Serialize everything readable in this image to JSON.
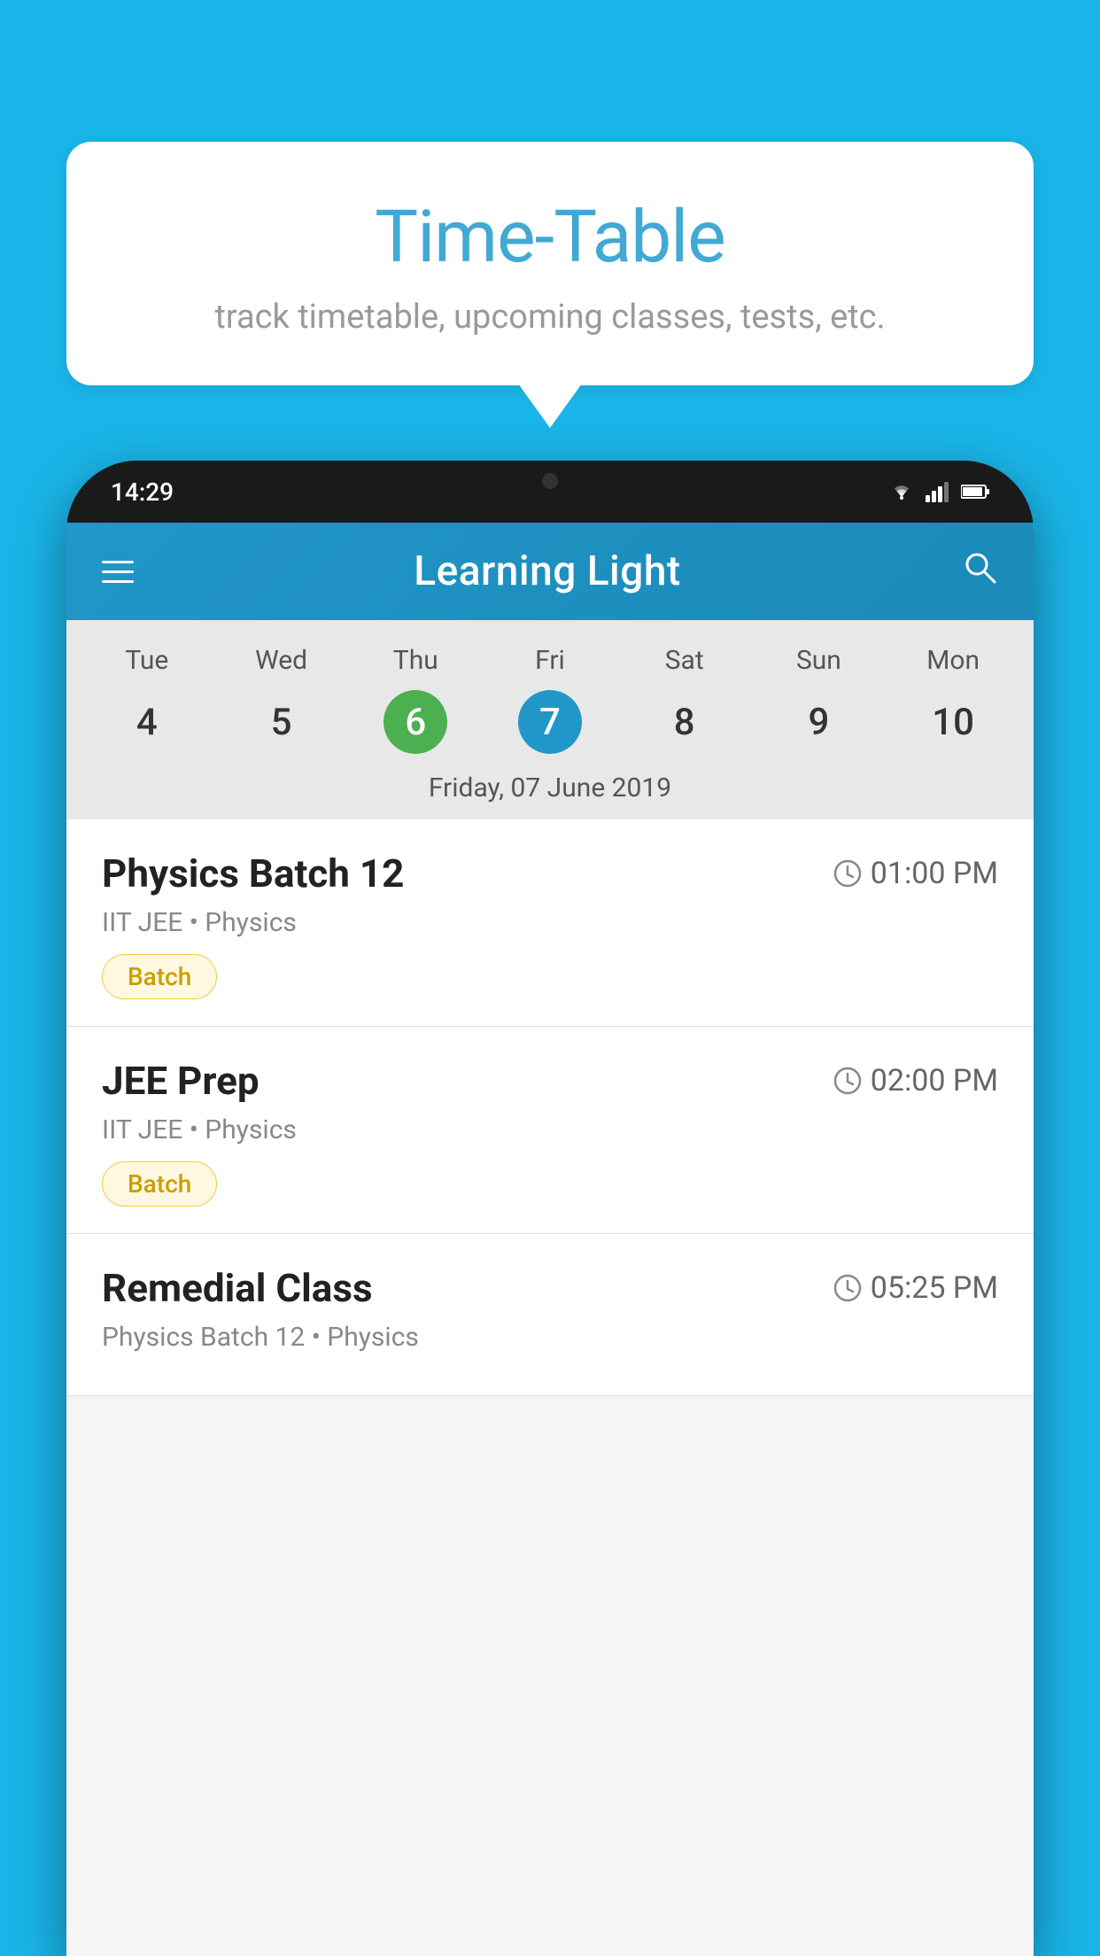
{
  "background_color": "#1ab5e8",
  "speech_bubble": {
    "title": "Time-Table",
    "subtitle": "track timetable, upcoming classes, tests, etc."
  },
  "phone": {
    "status_bar": {
      "time": "14:29",
      "icons": [
        "wifi",
        "signal",
        "battery"
      ]
    },
    "app_header": {
      "title": "Learning Light",
      "menu_icon": "hamburger",
      "search_icon": "search"
    },
    "calendar": {
      "days": [
        "Tue",
        "Wed",
        "Thu",
        "Fri",
        "Sat",
        "Sun",
        "Mon"
      ],
      "dates": [
        "4",
        "5",
        "6",
        "7",
        "8",
        "9",
        "10"
      ],
      "today_index": 2,
      "selected_index": 3,
      "selected_date_label": "Friday, 07 June 2019"
    },
    "schedule_items": [
      {
        "title": "Physics Batch 12",
        "time": "01:00 PM",
        "subtitle": "IIT JEE • Physics",
        "badge": "Batch"
      },
      {
        "title": "JEE Prep",
        "time": "02:00 PM",
        "subtitle": "IIT JEE • Physics",
        "badge": "Batch"
      },
      {
        "title": "Remedial Class",
        "time": "05:25 PM",
        "subtitle": "Physics Batch 12 • Physics",
        "badge": null
      }
    ]
  }
}
